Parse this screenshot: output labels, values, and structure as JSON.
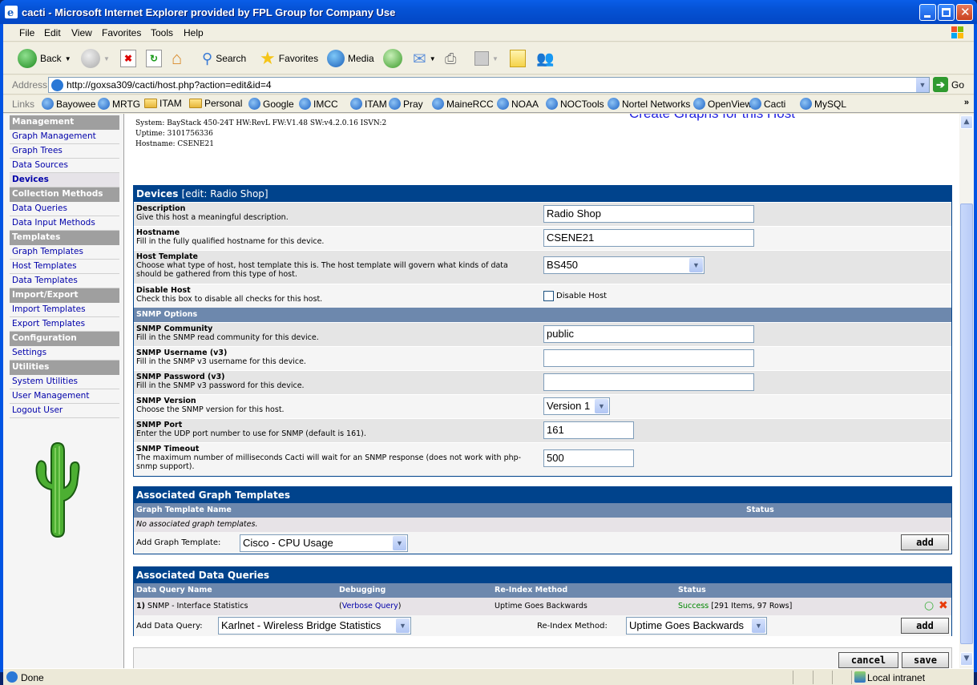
{
  "window": {
    "title": "cacti - Microsoft Internet Explorer provided by FPL Group for Company Use"
  },
  "menubar": [
    "File",
    "Edit",
    "View",
    "Favorites",
    "Tools",
    "Help"
  ],
  "toolbar": {
    "back": "Back",
    "search": "Search",
    "favorites": "Favorites",
    "media": "Media"
  },
  "address": {
    "label": "Address",
    "url": "http://goxsa309/cacti/host.php?action=edit&id=4",
    "go": "Go"
  },
  "links": {
    "label": "Links",
    "items": [
      {
        "label": "Bayowee",
        "icon": "ie-page-icon"
      },
      {
        "label": "MRTG",
        "icon": "ie-page-icon"
      },
      {
        "label": "ITAM",
        "icon": "folder-icon"
      },
      {
        "label": "Personal",
        "icon": "folder-icon"
      },
      {
        "label": "Google",
        "icon": "ie-page-icon"
      },
      {
        "label": "IMCC",
        "icon": "ie-page-icon"
      },
      {
        "label": "ITAM",
        "icon": "ie-page-icon"
      },
      {
        "label": "Pray",
        "icon": "ie-page-icon"
      },
      {
        "label": "MaineRCC",
        "icon": "ie-page-icon"
      },
      {
        "label": "NOAA",
        "icon": "ie-page-icon"
      },
      {
        "label": "NOCTools",
        "icon": "ie-page-icon"
      },
      {
        "label": "Nortel Networks",
        "icon": "ie-page-icon"
      },
      {
        "label": "OpenView",
        "icon": "ie-page-icon"
      },
      {
        "label": "Cacti",
        "icon": "ie-page-icon"
      },
      {
        "label": "MySQL",
        "icon": "ie-page-icon"
      }
    ],
    "overflow": "»"
  },
  "sidebar": {
    "groups": [
      {
        "header": "Management",
        "items": [
          {
            "label": "Graph Management"
          },
          {
            "label": "Graph Trees"
          },
          {
            "label": "Data Sources"
          },
          {
            "label": "Devices",
            "selected": true
          }
        ]
      },
      {
        "header": "Collection Methods",
        "items": [
          {
            "label": "Data Queries"
          },
          {
            "label": "Data Input Methods"
          }
        ]
      },
      {
        "header": "Templates",
        "items": [
          {
            "label": "Graph Templates"
          },
          {
            "label": "Host Templates"
          },
          {
            "label": "Data Templates"
          }
        ]
      },
      {
        "header": "Import/Export",
        "items": [
          {
            "label": "Import Templates"
          },
          {
            "label": "Export Templates"
          }
        ]
      },
      {
        "header": "Configuration",
        "items": [
          {
            "label": "Settings"
          }
        ]
      },
      {
        "header": "Utilities",
        "items": [
          {
            "label": "System Utilities"
          },
          {
            "label": "User Management"
          },
          {
            "label": "Logout User"
          }
        ]
      }
    ]
  },
  "sysinfo": {
    "system": "System: BayStack 450-24T HW:RevL FW:V1.48 SW:v4.2.0.16 ISVN:2",
    "uptime": "Uptime: 3101756336",
    "hostname": "Hostname: CSENE21",
    "create_graphs_link": "Create Graphs for this Host"
  },
  "devices": {
    "title": "Devices",
    "subtitle": "[edit: Radio Shop]",
    "fields": {
      "description": {
        "title": "Description",
        "help": "Give this host a meaningful description.",
        "value": "Radio Shop"
      },
      "hostname": {
        "title": "Hostname",
        "help": "Fill in the fully qualified hostname for this device.",
        "value": "CSENE21"
      },
      "host_template": {
        "title": "Host Template",
        "help": "Choose what type of host, host template this is. The host template will govern what kinds of data should be gathered from this type of host.",
        "value": "BS450"
      },
      "disable_host": {
        "title": "Disable Host",
        "help": "Check this box to disable all checks for this host.",
        "checkbox_label": "Disable Host",
        "checked": false
      }
    },
    "snmp_section": "SNMP Options",
    "snmp": {
      "community": {
        "title": "SNMP Community",
        "help": "Fill in the SNMP read community for this device.",
        "value": "public"
      },
      "username": {
        "title": "SNMP Username (v3)",
        "help": "Fill in the SNMP v3 username for this device.",
        "value": ""
      },
      "password": {
        "title": "SNMP Password (v3)",
        "help": "Fill in the SNMP v3 password for this device.",
        "value": ""
      },
      "version": {
        "title": "SNMP Version",
        "help": "Choose the SNMP version for this host.",
        "value": "Version 1"
      },
      "port": {
        "title": "SNMP Port",
        "help": "Enter the UDP port number to use for SNMP (default is 161).",
        "value": "161"
      },
      "timeout": {
        "title": "SNMP Timeout",
        "help": "The maximum number of milliseconds Cacti will wait for an SNMP response (does not work with php-snmp support).",
        "value": "500"
      }
    }
  },
  "graph_templates": {
    "title": "Associated Graph Templates",
    "columns": [
      "Graph Template Name",
      "Status"
    ],
    "empty": "No associated graph templates.",
    "add_label": "Add Graph Template:",
    "add_value": "Cisco - CPU Usage",
    "add_button": "add"
  },
  "data_queries": {
    "title": "Associated Data Queries",
    "columns": [
      "Data Query Name",
      "Debugging",
      "Re-Index Method",
      "Status"
    ],
    "rows": [
      {
        "num": "1)",
        "name": "SNMP - Interface Statistics",
        "debug_pre": "(",
        "debug_link": "Verbose Query",
        "debug_post": ")",
        "reindex": "Uptime Goes Backwards",
        "status": "Success",
        "status_detail": "[291 Items, 97 Rows]"
      }
    ],
    "add_label": "Add Data Query:",
    "add_value": "Karlnet - Wireless Bridge Statistics",
    "reindex_label": "Re-Index Method:",
    "reindex_value": "Uptime Goes Backwards",
    "add_button": "add"
  },
  "actions": {
    "cancel": "cancel",
    "save": "save"
  },
  "status": {
    "text": "Done",
    "zone": "Local intranet"
  },
  "colors": {
    "header": "#00438c",
    "section": "#6d88ad",
    "success": "#008800",
    "link": "#0000aa"
  }
}
